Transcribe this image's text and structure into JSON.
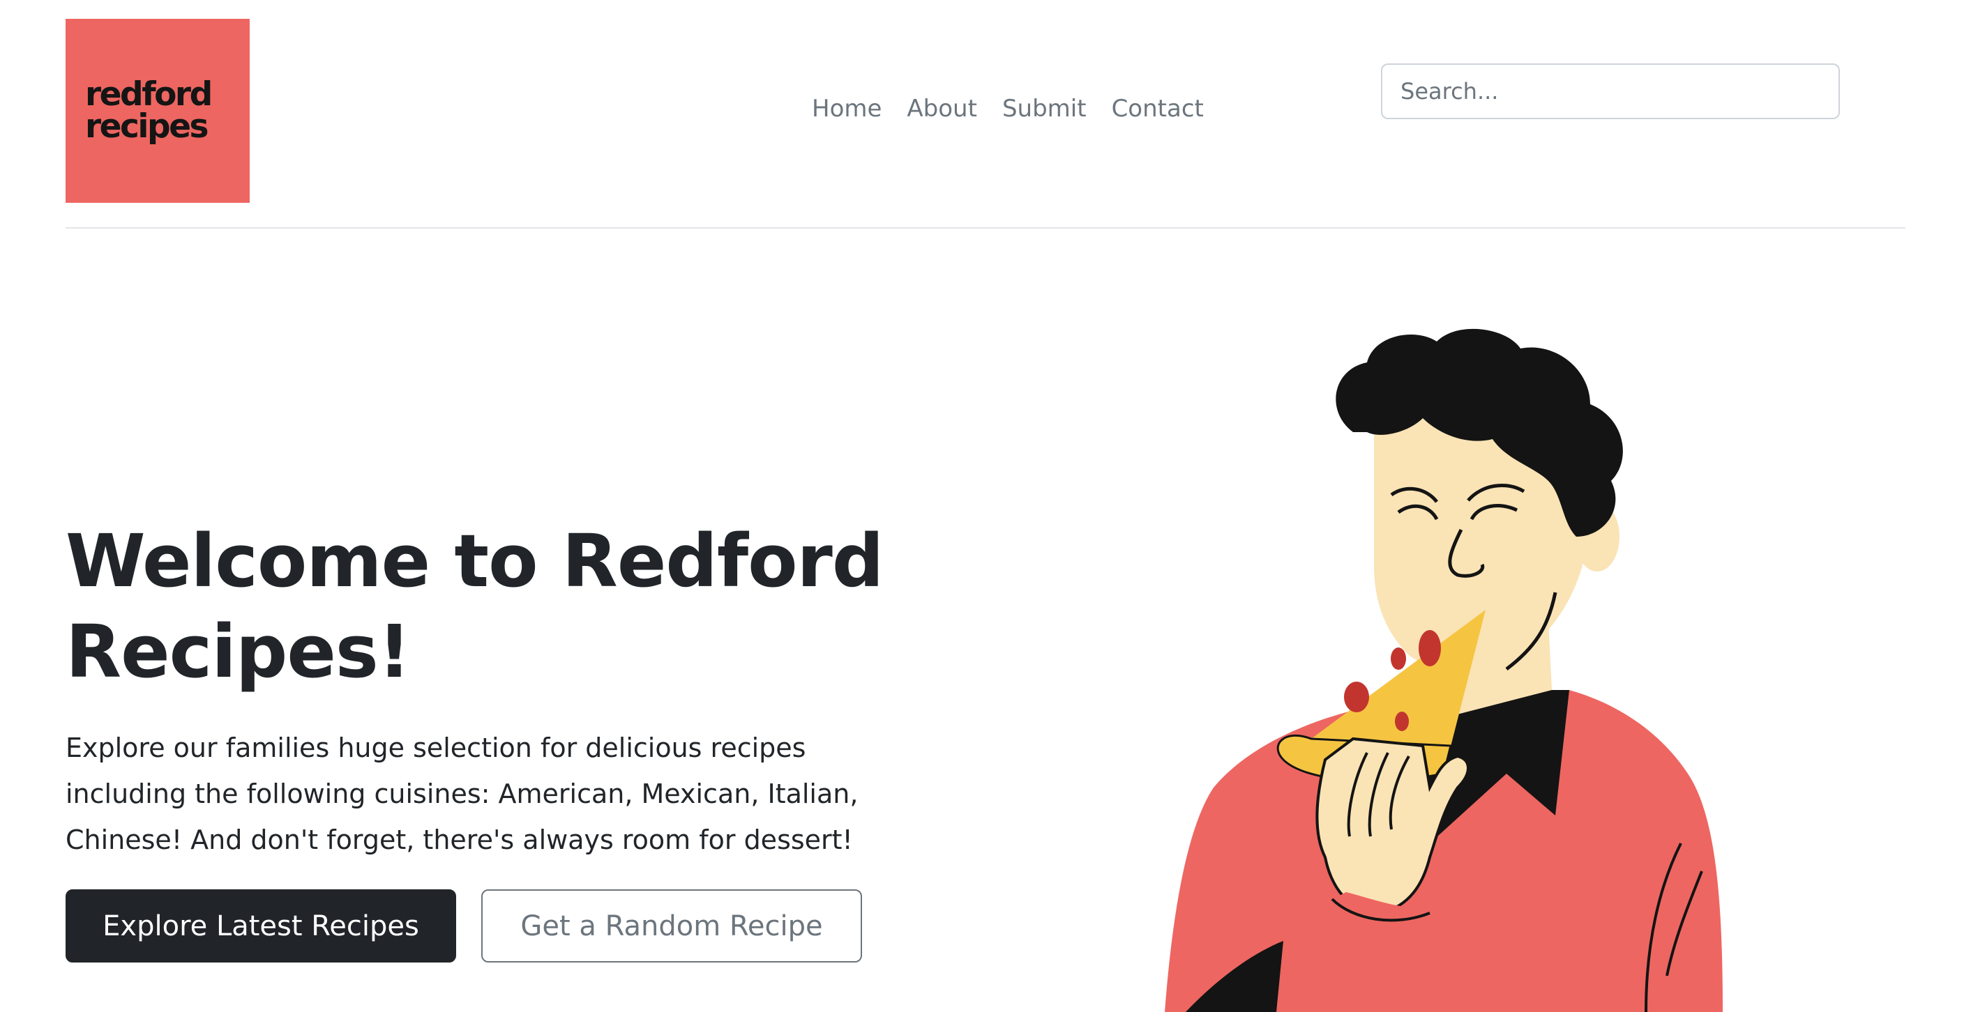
{
  "logo": {
    "line1": "redford",
    "line2": "recipes"
  },
  "nav": {
    "items": [
      "Home",
      "About",
      "Submit",
      "Contact"
    ]
  },
  "search": {
    "placeholder": "Search..."
  },
  "hero": {
    "title": "Welcome to Redford Recipes!",
    "lead": "Explore our families huge selection for delicious recipes including the following cuisines: American, Mexican, Italian, Chinese! And don't forget, there's always room for dessert!",
    "primary_button": "Explore Latest Recipes",
    "secondary_button": "Get a Random Recipe"
  },
  "illustration": {
    "icon": "person-eating-pizza-illustration"
  },
  "colors": {
    "brand": "#ee6661",
    "dark": "#212529",
    "muted": "#6c757d",
    "pizza": "#f5c542",
    "pepperoni": "#c2352e",
    "skin": "#fae3b5"
  }
}
